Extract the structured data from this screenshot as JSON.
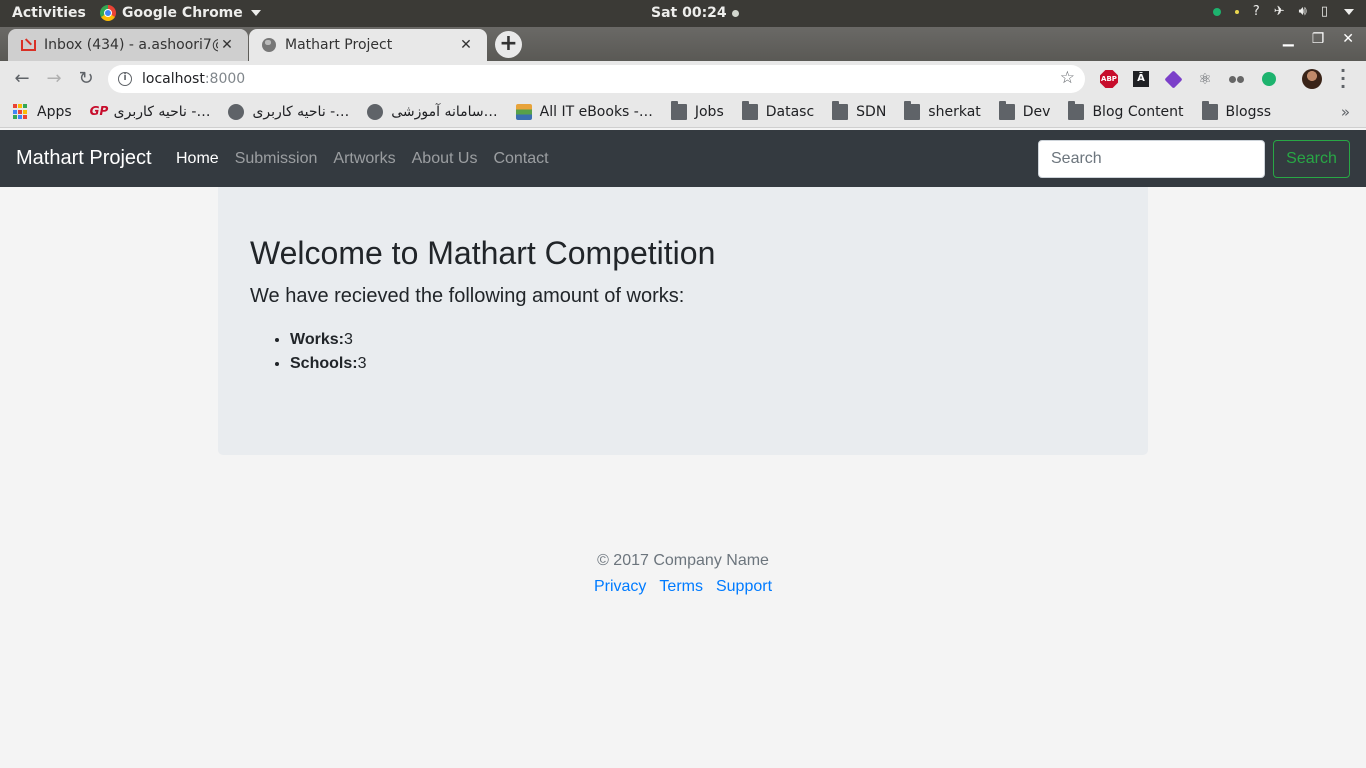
{
  "system_bar": {
    "activities": "Activities",
    "app_name": "Google Chrome",
    "clock": "Sat 00:24"
  },
  "tabs": [
    {
      "title": "Inbox (434) - a.ashoori7@",
      "icon": "gmail-icon",
      "active": false
    },
    {
      "title": "Mathart Project",
      "icon": "globe-icon",
      "active": true
    }
  ],
  "address_bar": {
    "host": "localhost",
    "port": ":8000"
  },
  "bookmarks": [
    {
      "label": "Apps",
      "icon": "apps-icon"
    },
    {
      "label": "ناحیه کاربری -…",
      "icon": "gp-icon"
    },
    {
      "label": "ناحیه کاربری -…",
      "icon": "globe-icon"
    },
    {
      "label": "سامانه آموزشی…",
      "icon": "globe-icon"
    },
    {
      "label": "All IT eBooks -…",
      "icon": "books-icon"
    },
    {
      "label": "Jobs",
      "icon": "folder-icon"
    },
    {
      "label": "Datasc",
      "icon": "folder-icon"
    },
    {
      "label": "SDN",
      "icon": "folder-icon"
    },
    {
      "label": "sherkat",
      "icon": "folder-icon"
    },
    {
      "label": "Dev",
      "icon": "folder-icon"
    },
    {
      "label": "Blog Content",
      "icon": "folder-icon"
    },
    {
      "label": "Blogss",
      "icon": "folder-icon"
    }
  ],
  "navbar": {
    "brand": "Mathart Project",
    "links": [
      "Home",
      "Submission",
      "Artworks",
      "About Us",
      "Contact"
    ],
    "active_link": "Home",
    "search_placeholder": "Search",
    "search_button": "Search",
    "accent": "#28a745"
  },
  "jumbotron": {
    "heading": "Welcome to Mathart Competition",
    "lead": "We have recieved the following amount of works:",
    "stats": [
      {
        "label": "Works:",
        "value": "3"
      },
      {
        "label": "Schools:",
        "value": "3"
      }
    ]
  },
  "footer": {
    "copyright": "© 2017 Company Name",
    "links": [
      "Privacy",
      "Terms",
      "Support"
    ],
    "link_color": "#007bff"
  }
}
